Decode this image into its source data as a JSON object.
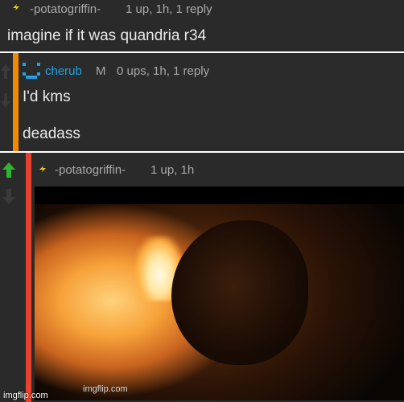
{
  "comment1": {
    "username": "-potatogriffin-",
    "meta": "1 up, 1h, 1 reply",
    "text": "imagine if it was quandria r34"
  },
  "comment2": {
    "username": "cherub",
    "badge": "M",
    "meta": "0 ups, 1h, 1 reply",
    "line1": "I'd kms",
    "line2": "deadass",
    "accent_color": "#f08a00"
  },
  "comment3": {
    "username": "-potatogriffin-",
    "meta": "1 up, 1h",
    "accent_color": "#e8412c",
    "upvote_color": "#2fb52f",
    "image_watermark": "imgflip.com"
  },
  "page_watermark": "imgflip.com"
}
